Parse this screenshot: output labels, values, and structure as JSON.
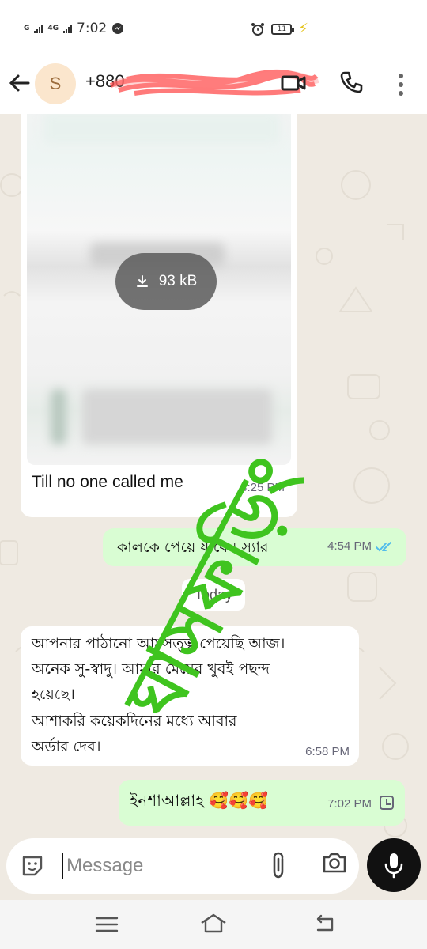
{
  "status_bar": {
    "network1": "G",
    "network2": "4G",
    "time": "7:02",
    "battery": "11"
  },
  "header": {
    "avatar_letter": "S",
    "contact_visible": "+880"
  },
  "messages": {
    "image_msg": {
      "file_size": "93 kB",
      "caption": "Till no one called me",
      "time": "4:25 PM"
    },
    "out1": {
      "text": "কালকে পেয়ে যাবেন স্যার",
      "time": "4:54 PM"
    },
    "date_chip": "Today",
    "in2": {
      "lines": [
        "আপনার পাঠানো আমসত্ত্ব পেয়েছি আজ।",
        "অনেক সু-স্বাদু। আমার মেয়ের খুবই পছন্দ",
        "হয়েছে।",
        "আশাকরি কয়েকদিনের মধ্যে আবার",
        "অর্ডার দেব।"
      ],
      "time": "6:58 PM"
    },
    "out2": {
      "text": "ইনশাআল্লাহ 🥰🥰🥰",
      "time": "7:02 PM"
    }
  },
  "watermark": "ঘাসফড়িং",
  "composer": {
    "placeholder": "Message"
  },
  "icons": {
    "back": "arrow-left-icon",
    "video": "video-call-icon",
    "call": "phone-icon",
    "more": "more-vertical-icon",
    "emoji": "sticker-icon",
    "attach": "paperclip-icon",
    "camera": "camera-icon",
    "mic": "microphone-icon",
    "download": "download-icon"
  },
  "colors": {
    "outgoing_bubble": "#d9fdd3",
    "incoming_bubble": "#ffffff",
    "chat_bg": "#efeae2",
    "read_ticks": "#53bdeb",
    "watermark": "#3fc41f"
  }
}
